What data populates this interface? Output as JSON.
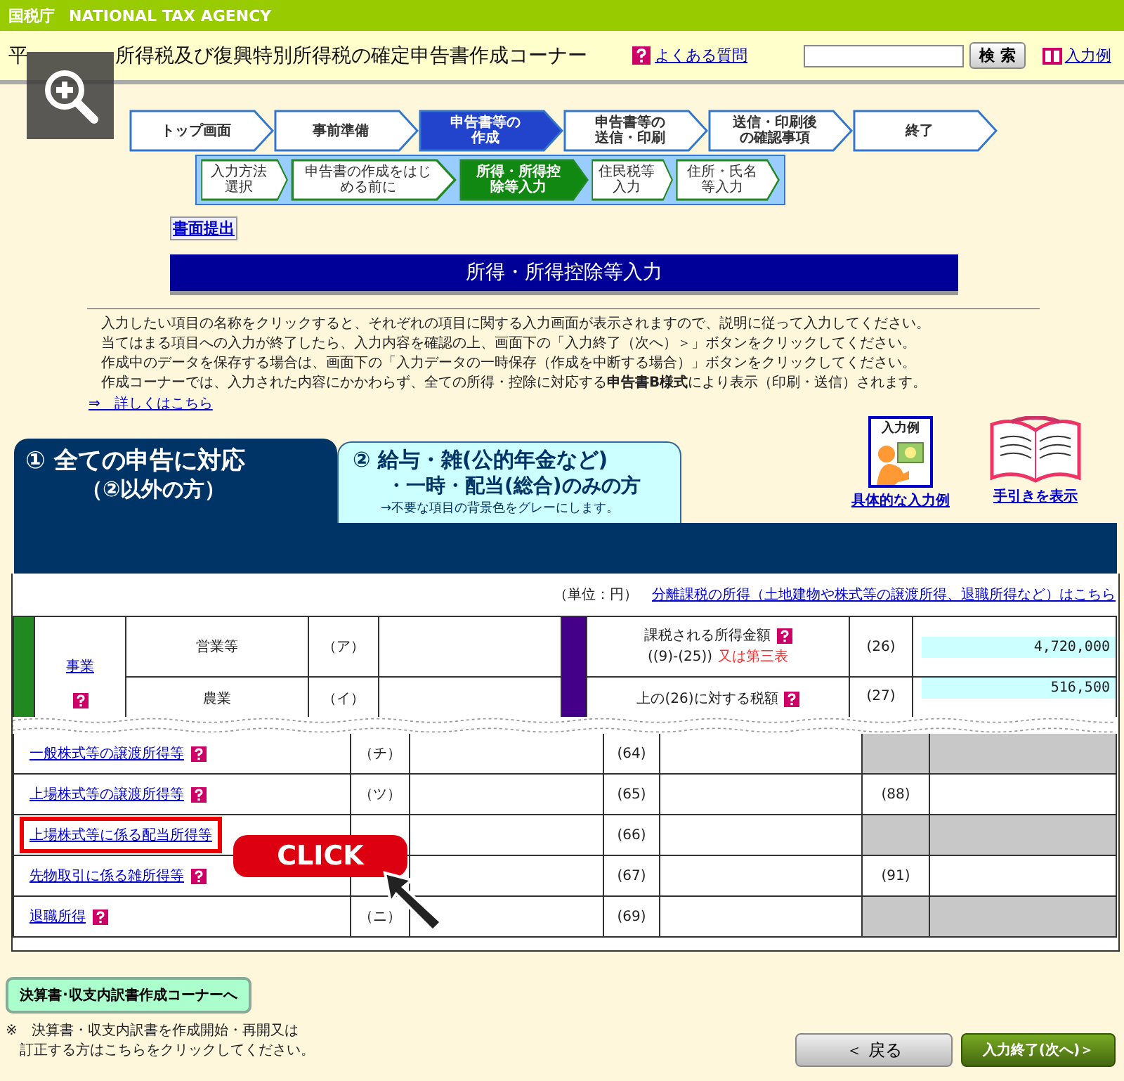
{
  "header": {
    "agency": "国税庁",
    "agency_en": "NATIONAL TAX AGENCY"
  },
  "title_bar": {
    "title_parts": [
      "平",
      "所得税及び復興特別所得税の確定申告書作成コーナー"
    ],
    "faq_link": "よくある質問",
    "search_button": "検 索",
    "example_link": "入力例"
  },
  "steps": [
    {
      "lines": [
        "トップ画面"
      ],
      "selected": false
    },
    {
      "lines": [
        "事前準備"
      ],
      "selected": false
    },
    {
      "lines": [
        "申告書等の",
        "作成"
      ],
      "selected": true
    },
    {
      "lines": [
        "申告書等の",
        "送信・印刷"
      ],
      "selected": false
    },
    {
      "lines": [
        "送信・印刷後",
        "の確認事項"
      ],
      "selected": false
    },
    {
      "lines": [
        "終了"
      ],
      "selected": false
    }
  ],
  "substeps": [
    {
      "lines": [
        "入力方法",
        "選択"
      ],
      "selected": false
    },
    {
      "lines": [
        "申告書の作成をはじ",
        "める前に"
      ],
      "selected": false
    },
    {
      "lines": [
        "所得・所得控",
        "除等入力"
      ],
      "selected": true
    },
    {
      "lines": [
        "住民税等",
        "入力"
      ],
      "selected": false
    },
    {
      "lines": [
        "住所・氏名",
        "等入力"
      ],
      "selected": false
    }
  ],
  "paper_button": "書面提出",
  "page_title": "所得・所得控除等入力",
  "instructions": [
    "入力したい項目の名称をクリックすると、それぞれの項目に関する入力画面が表示されますので、説明に従って入力してください。",
    "当てはまる項目への入力が終了したら、入力内容を確認の上、画面下の「入力終了（次へ）＞」ボタンをクリックしてください。",
    "作成中のデータを保存する場合は、画面下の「入力データの一時保存（作成を中断する場合）」ボタンをクリックしてください。",
    "作成コーナーでは、入力された内容にかかわらず、全ての所得・控除に対応する**申告書B様式**により表示（印刷・送信）されます。"
  ],
  "details_link": "⇒　詳しくはこちら",
  "tabs": [
    {
      "title": "① 全ての申告に対応",
      "subtitle": "（②以外の方）",
      "selected": true
    },
    {
      "title": "② 給与・雑(公的年金など)",
      "subtitle": "・一時・配当(総合)のみの方",
      "note": "→不要な項目の背景色をグレーにします。",
      "selected": false
    }
  ],
  "resources": [
    {
      "kind": "example",
      "badge": "入力例",
      "label": "具体的な入力例"
    },
    {
      "kind": "guide",
      "label": "手引きを表示"
    }
  ],
  "table": {
    "unit": "（単位：円）",
    "separate_link": "分離課税の所得（土地建物や株式等の譲渡所得、退職所得など）はこちら",
    "group": {
      "label": "事業",
      "help": true
    },
    "top_rows": [
      {
        "name": "営業等",
        "kana": "（ア）",
        "right_label": "課税される所得金額",
        "help": true,
        "right_sub": "((9)-(25))",
        "right_note": "又は第三表",
        "num": "(26)",
        "value": "4,720,000"
      },
      {
        "name": "農業",
        "kana": "（イ）",
        "right_label": "上の(26)に対する税額",
        "help": true,
        "num": "(27)",
        "value": "516,500"
      }
    ],
    "rows": [
      {
        "label": "一般株式等の譲渡所得等",
        "help": true,
        "kana": "（チ）",
        "num": "(64)",
        "shaded": true,
        "highlighted": false
      },
      {
        "label": "上場株式等の譲渡所得等",
        "help": true,
        "kana": "（ツ）",
        "num": "(65)",
        "num2": "(88)",
        "shaded": false,
        "highlighted": false
      },
      {
        "label": "上場株式等に係る配当所得等",
        "help": false,
        "num": "(66)",
        "shaded": true,
        "highlighted": true
      },
      {
        "label": "先物取引に係る雑所得等",
        "help": true,
        "num": "(67)",
        "num2": "(91)",
        "shaded": false,
        "highlighted": false
      },
      {
        "label": "退職所得",
        "help": true,
        "kana": "（ニ）",
        "num": "(69)",
        "shaded": true,
        "highlighted": false
      }
    ]
  },
  "callout": "CLICK",
  "settlement_button": "決算書･収支内訳書作成コーナーへ",
  "note_lines": [
    "※　決算書・収支内訳書を作成開始・再開又は",
    "訂正する方はこちらをクリックしてください。"
  ],
  "buttons": [
    {
      "kind": "back",
      "label": "＜ 戻る"
    },
    {
      "kind": "next",
      "label": "入力終了(次へ)＞"
    }
  ]
}
